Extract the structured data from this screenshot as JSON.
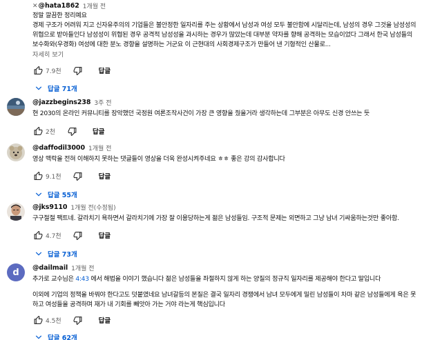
{
  "comments": [
    {
      "author": "@hata1862",
      "time": "1개월 전",
      "lines": [
        "정말 깔끔한 정리예요",
        "경제 구조가 어려워 지고 신자유주의의 기업들은 불안정한 일자리를 주는 상황에서 남성과 여성 모두 불안함에 시달리는데, 남성의 경우 그것을 남성성의",
        "위협으로 받아들인다 남성성이 위협된 경우 공격적 남성성을 과시하는 경우가 많았는데 대부분 약자를 향해 공격하는 모습이었다 그래서 한국 남성들의",
        "보수화와(우경화) 여성에 대한 분노 경향을 설명하는 거군요 이 근현대의 사회경제구조가 만들어 낸 기형적인 산물로..."
      ],
      "more": "자세히 보기",
      "likes": "7.9천",
      "reply": "답글",
      "replies": "답글 71개"
    },
    {
      "author": "@jazzbegins238",
      "time": "3주 전",
      "lines": [
        "현 2030의 온라인 커뮤니티를 장악했던 국정원 여론조작사건이 가장 큰 영향을 줬을거라 생각하는데 그부분은 아무도 신경 안쓰는 듯"
      ],
      "likes": "2천",
      "reply": "답글"
    },
    {
      "author": "@daffodil3000",
      "time": "1개월 전",
      "lines": [
        "영상 맥락을 전혀 이해하지 못하는 댓글들이 영상을 더욱 완성시켜주네요 ㅎㅎ 좋은 강의 감사합니다"
      ],
      "likes": "9.1천",
      "reply": "답글",
      "replies": "답글 55개"
    },
    {
      "author": "@jks9110",
      "time": "1개월 전(수정됨)",
      "lines": [
        "구구절절 팩트네. 갈라치기 욕하면서 갈라치기에 가장 잘 이용당하는게 젊은 남성들임. 구조적 문제는 외면하고 그냥 남녀 기싸움하는것만 좋아함."
      ],
      "likes": "4.7천",
      "reply": "답글",
      "replies": "답글 73개"
    },
    {
      "author": "@dailmail",
      "time": "1개월 전",
      "avatar_letter": "d",
      "line1_pre": "추가로 교수님은 ",
      "timestamp": "4:43",
      "line1_post": " 에서 해법을 이야기 했습니다 젊은 남성들을 좌절하지 않게 하는 양질의 정규직 일자리를 제공해야 한다고 말입니다",
      "lines": [
        "이외에 기업의 정책을 바꿔야 한다고도 덧붙였네요 남녀갈등의 본질은 결국 일자리 경쟁에서 남녀 모두에게 밀린 남성들이 차마 같은 남성들에게 욕은 못",
        "하고 여성들을 공격하며 재가 내 기회를 빼앗아 가는 거야 라는게 핵심입니다"
      ],
      "likes": "4.5천",
      "reply": "답글",
      "replies": "답글 62개"
    }
  ],
  "icons": {
    "mark": "x-mark-icon",
    "like": "thumb-up-icon",
    "dislike": "thumb-down-icon",
    "replies": "chevron-down-icon"
  },
  "colors": {
    "link": "#065fd4",
    "secondary": "#606060"
  }
}
